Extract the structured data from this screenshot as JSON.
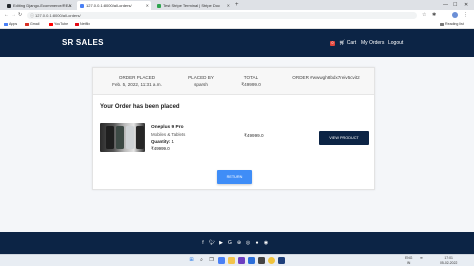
{
  "browser": {
    "tabs": [
      {
        "label": "Editing Django-Ecommerce/REA",
        "active": false,
        "favicon_color": "#24292e"
      },
      {
        "label": "127.0.0.1:8000/all-orders/",
        "active": true,
        "favicon_color": "#4a80f5"
      },
      {
        "label": "Test Stripe Terminal | Stripe Doc",
        "active": false,
        "favicon_color": "#2ea44f"
      }
    ],
    "new_tab": "+",
    "url": "127.0.0.1:8000/all-orders/",
    "bookmarks": [
      {
        "label": "Apps",
        "color": "#4a80f5"
      },
      {
        "label": "Gmail",
        "color": "#d93025"
      },
      {
        "label": "YouTube",
        "color": "#ff0000"
      },
      {
        "label": "Netflix",
        "color": "#e50914"
      }
    ],
    "reading_list": "Reading list"
  },
  "site": {
    "brand": "SR SALES",
    "cart_count": "0",
    "nav": {
      "cart": "Cart",
      "my_orders": "My Orders",
      "logout": "Logout"
    }
  },
  "order": {
    "placed_label": "ORDER PLACED",
    "placed_value": "Feb. 5, 2022, 11:31 a.m.",
    "placed_by_label": "PLACED BY",
    "placed_by_value": "sparsh",
    "total_label": "TOTAL",
    "total_value": "₹49999.0",
    "order_id": "ORDER #wwwgh8bdx7reiv5cvit2",
    "heading": "Your Order has been placed",
    "product": {
      "name": "Oneplus 9 Pro",
      "category": "Mobiles & Tablets",
      "quantity_label": "Quantity:",
      "quantity_value": "1",
      "price": "₹49999.0",
      "line_total": "₹49999.0"
    },
    "view_button": "VIEW PRODUCT",
    "return_button": "RETURN"
  },
  "footer": {
    "social_icons": [
      "facebook-icon",
      "twitter-icon",
      "youtube-icon",
      "google-icon",
      "pinterest-icon",
      "discord-icon",
      "github-icon",
      "reddit-icon"
    ]
  },
  "taskbar": {
    "weather": "ENG",
    "region": "IN",
    "time": "17:01",
    "date": "05-02-2022"
  }
}
